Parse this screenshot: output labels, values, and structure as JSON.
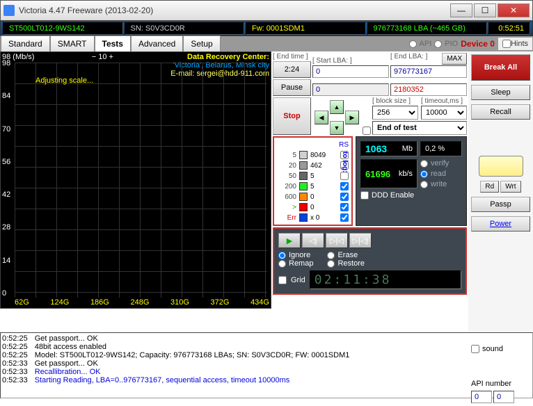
{
  "window": {
    "title": "Victoria 4.47  Freeware (2013-02-20)"
  },
  "info": {
    "model": "ST500LT012-9WS142",
    "sn": "SN: S0V3CD0R",
    "fw": "Fw: 0001SDM1",
    "lba": "976773168 LBA (~465 GB)",
    "time": "0:52:51"
  },
  "toprow": {
    "api": "API",
    "pio": "PIO",
    "device": "Device 0",
    "hints": "Hints"
  },
  "tabs": {
    "standard": "Standard",
    "smart": "SMART",
    "tests": "Tests",
    "advanced": "Advanced",
    "setup": "Setup"
  },
  "graph": {
    "zoom": "− 10 +",
    "unit": "98 (Mb/s)",
    "adjusting": "Adjusting scale...",
    "recovery_title": "Data Recovery Center:",
    "recovery_loc": "'Victoria', Belarus, Minsk city",
    "recovery_mail": "E-mail: sergei@hdd-911.com",
    "y": [
      "98",
      "84",
      "70",
      "56",
      "42",
      "28",
      "14",
      "0"
    ],
    "x": [
      "62G",
      "124G",
      "186G",
      "248G",
      "310G",
      "372G",
      "434G"
    ]
  },
  "controls": {
    "endtime_lbl": "[ End time ]",
    "endtime": "2:24",
    "startlba_lbl": "[ Start LBA: ]",
    "startlba": "0",
    "startlba_cur": "0",
    "endlba_lbl": "[ End LBA: ]",
    "endlba": "976773167",
    "cur": "2180352",
    "max": "MAX",
    "pause": "Pause",
    "stop": "Stop",
    "blocksize_lbl": "[ block size ]",
    "blocksize": "256",
    "timeout_lbl": "[ timeout,ms ]",
    "timeout": "10000",
    "endtest": "End of test"
  },
  "stats": {
    "mb_val": "1063",
    "mb_unit": "Mb",
    "pct": "0,2  %",
    "kbs_val": "61696",
    "kbs_unit": "kb/s",
    "verify": "verify",
    "read": "read",
    "write": "write",
    "ddd": "DDD Enable"
  },
  "blocks": {
    "rs": "RS",
    "tolog": "to log:",
    "rows": [
      {
        "thr": "5",
        "color": "#d0d0d0",
        "cnt": "8049"
      },
      {
        "thr": "20",
        "color": "#999",
        "cnt": "462"
      },
      {
        "thr": "50",
        "color": "#666",
        "cnt": "5"
      },
      {
        "thr": "200",
        "color": "#2e2",
        "cnt": "5"
      },
      {
        "thr": "600",
        "color": "#f80",
        "cnt": "0"
      },
      {
        "thr": ">",
        "color": "#e00",
        "cnt": "0"
      },
      {
        "thr": "Err",
        "color": "#04d",
        "cnt": "x 0"
      }
    ]
  },
  "actions": {
    "ignore": "Ignore",
    "erase": "Erase",
    "remap": "Remap",
    "restore": "Restore",
    "grid": "Grid",
    "timer": "02:11:38"
  },
  "side": {
    "break": "Break All",
    "sleep": "Sleep",
    "recall": "Recall",
    "passp": "Passp",
    "power": "Power",
    "rd": "Rd",
    "wrt": "Wrt",
    "sound": "sound",
    "api": "API number",
    "api0": "0",
    "api1": "0"
  },
  "log": [
    {
      "t": "0:52:25",
      "m": "Get passport... OK"
    },
    {
      "t": "0:52:25",
      "m": "48bit access enabled"
    },
    {
      "t": "0:52:25",
      "m": "Model: ST500LT012-9WS142; Capacity: 976773168 LBAs; SN: S0V3CD0R; FW: 0001SDM1"
    },
    {
      "t": "0:52:33",
      "m": "Get passport... OK"
    },
    {
      "t": "0:52:33",
      "m": "Recallibration... OK",
      "c": "blue"
    },
    {
      "t": "0:52:33",
      "m": "Starting Reading, LBA=0..976773167, sequential access, timeout 10000ms",
      "c": "blue"
    }
  ]
}
